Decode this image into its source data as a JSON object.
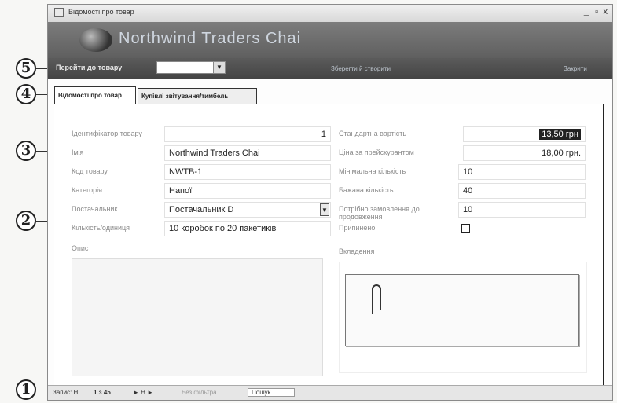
{
  "window": {
    "title": "Відомості про товар",
    "controls": [
      "_",
      "▫",
      "x"
    ]
  },
  "banner": {
    "company": "Northwind Traders Chai"
  },
  "navbar": {
    "goto_label": "Перейти до товару",
    "goto_value": "",
    "link_center": "Зберегти й створити",
    "link_right": "Закрити"
  },
  "tabs": [
    {
      "label": "Відомості про товар",
      "active": true
    },
    {
      "label": "Купівлі звітування/тимбель",
      "active": false
    }
  ],
  "form": {
    "left": [
      {
        "label": "Ідентифікатор товару",
        "value": "1",
        "align": "right"
      },
      {
        "label": "Ім'я",
        "value": "Northwind Traders Chai",
        "align": "left"
      },
      {
        "label": "Код товару",
        "value": "NWTB-1",
        "align": "left"
      },
      {
        "label": "Категорія",
        "value": "Напої",
        "align": "left"
      },
      {
        "label": "Постачальник",
        "value": "Постачальник D",
        "align": "left",
        "dropdown": true
      },
      {
        "label": "Кількість/одиниця",
        "value": "10 коробок по 20 пакетиків",
        "align": "left"
      }
    ],
    "right": [
      {
        "label": "Стандартна вартість",
        "value": "13,50 грн",
        "align": "right",
        "selected": true
      },
      {
        "label": "Ціна за прейскурантом",
        "value": "18,00 грн.",
        "align": "right"
      },
      {
        "label": "Мінімальна кількість",
        "value": "10",
        "align": "left"
      },
      {
        "label": "Бажана кількість",
        "value": "40",
        "align": "left"
      },
      {
        "label": "Потрібно замовлення до продовження",
        "value": "10",
        "align": "left"
      }
    ],
    "discontinued_label": "Припинено",
    "discontinued_checked": false,
    "description_label": "Опис",
    "attachments_label": "Вкладення"
  },
  "statusbar": {
    "record_label": "Запис: H",
    "position": "1 з 45",
    "nav_next": "► H ►",
    "filter": "Без фільтра",
    "search": "Пошук"
  },
  "callouts": [
    "5",
    "4",
    "3",
    "2",
    "1"
  ]
}
